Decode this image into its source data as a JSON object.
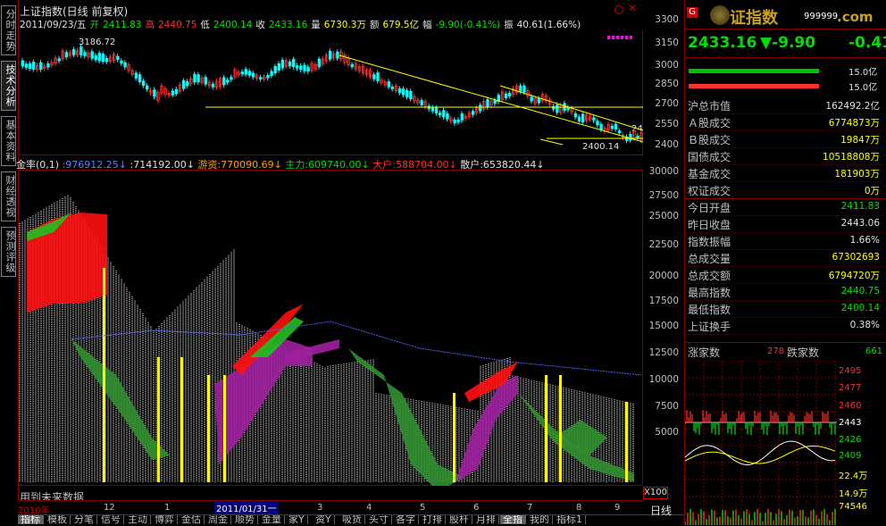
{
  "left_tabs": [
    "分时走势",
    "技术分析",
    "基本资料",
    "财经透视",
    "预测评级"
  ],
  "chart": {
    "title": "上证指数(日线 前复权)",
    "info": {
      "date": "2011/09/23/五",
      "open_label": "开",
      "open": "2411.83",
      "high_label": "高",
      "high": "2440.75",
      "low_label": "低",
      "low": "2400.14",
      "close_label": "收",
      "close": "2433.16",
      "vol_label": "量",
      "vol": "6730.3万",
      "amt_label": "额",
      "amt": "679.5亿",
      "chg_label": "幅",
      "chg": "-9.90(-0.41%)",
      "ju_label": "振",
      "ju": "40.61(1.66%)"
    },
    "price_axis": [
      "3300",
      "3150",
      "3000",
      "2850",
      "2700",
      "2550",
      "2400"
    ],
    "annot_high": "3186.72",
    "annot_low": "2400.14",
    "annot_right": "24",
    "indicator_bar": {
      "name": "金率(0,1)",
      "v1": ":976912.25",
      "v2": ":714192.00",
      "youzi_label": "游资",
      "youzi": ":770090.69",
      "zhuli_label": "主力",
      "zhuli": ":609740.00",
      "dahu_label": "大户",
      "dahu": ":588704.00",
      "sanhu_label": "散户",
      "sanhu": ":653820.44"
    },
    "indicator_axis": [
      "30000",
      "27500",
      "25000",
      "22500",
      "20000",
      "17500",
      "15000",
      "12500",
      "10000",
      "7500",
      "5000"
    ],
    "future_text": "用到未来数据",
    "x_labels": [
      "2010年",
      "12",
      "1",
      "2011/01/31一",
      "3",
      "4",
      "5",
      "6",
      "7",
      "8",
      "9"
    ],
    "x_scale": "X100"
  },
  "bottom_tabs": [
    "指标",
    "模板",
    "分笔",
    "信号",
    "主动",
    "博弈",
    "金估",
    "周金",
    "顺势",
    "金量",
    "家Y",
    "资Y",
    "吸货",
    "头寸",
    "各字",
    "打排",
    "股杆",
    "月排",
    "全指",
    "我的",
    "指标1"
  ],
  "right": {
    "logo_g": "G",
    "logo_text": "证指数",
    "code": "999999",
    "domain": ".com",
    "price": "2433.16",
    "change": "▼-9.90",
    "pct": "-0.41",
    "buy_amt": "15.0亿",
    "sell_amt": "15.0亿",
    "rows": [
      {
        "label": "沪总市值",
        "value": "162492.2亿",
        "color": "white"
      },
      {
        "label": "Ａ股成交",
        "value": "6774873万",
        "color": "yellow"
      },
      {
        "label": "Ｂ股成交",
        "value": "19847万",
        "color": "yellow"
      },
      {
        "label": "国债成交",
        "value": "10518808万",
        "color": "yellow"
      },
      {
        "label": "基金成交",
        "value": "181903万",
        "color": "yellow"
      },
      {
        "label": "权证成交",
        "value": "0万",
        "color": "yellow"
      },
      {
        "label": "今日开盘",
        "value": "2411.83",
        "color": "green"
      },
      {
        "label": "昨日收盘",
        "value": "2443.06",
        "color": "white"
      },
      {
        "label": "指数振幅",
        "value": "1.66%",
        "color": "white"
      },
      {
        "label": "总成交量",
        "value": "67302693",
        "color": "yellow"
      },
      {
        "label": "总成交额",
        "value": "6794720万",
        "color": "yellow"
      },
      {
        "label": "最高指数",
        "value": "2440.75",
        "color": "green"
      },
      {
        "label": "最低指数",
        "value": "2400.14",
        "color": "green"
      },
      {
        "label": "上证换手",
        "value": "0.38%",
        "color": "white"
      }
    ],
    "up_label": "涨家数",
    "up_count": "278",
    "down_label": "跌家数",
    "down_count": "661",
    "mini_axis": [
      "2495",
      "2477",
      "2460",
      "2443",
      "2426",
      "2409",
      "22.4万",
      "14.9万",
      "74546"
    ],
    "period": "日线"
  },
  "colors": {
    "bg": "#000000",
    "up": "#ff3030",
    "down": "#00ffff",
    "grid": "#800000",
    "yellow": "#ffff00"
  }
}
